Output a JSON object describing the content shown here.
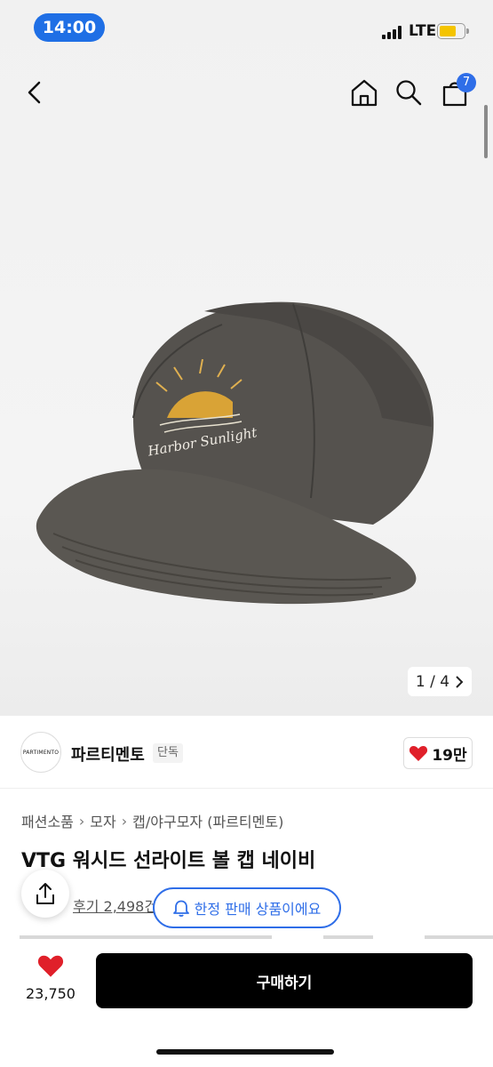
{
  "status_bar": {
    "time": "14:00",
    "network": "LTE"
  },
  "nav": {
    "cart_count": "7"
  },
  "gallery": {
    "pager": "1 / 4",
    "cap_text": "Harbor Sunlight"
  },
  "seller": {
    "logo_text": "PARTIMENTO",
    "brand_name": "파르티멘토",
    "exclusive_tag": "단독",
    "likes": "19만"
  },
  "breadcrumb": [
    "패션소품",
    "모자",
    "캡/야구모자 (파르티멘토)"
  ],
  "product": {
    "title": "VTG 워시드 선라이트 볼 캡 네이비",
    "review_text": "후기 2,498건"
  },
  "limited_badge": "한정 판매 상품이에요",
  "bottom_bar": {
    "wish_count": "23,750",
    "buy_label": "구매하기"
  },
  "colors": {
    "accent": "#2f6ee8",
    "heart": "#e0202a",
    "buy_button": "#000000"
  }
}
